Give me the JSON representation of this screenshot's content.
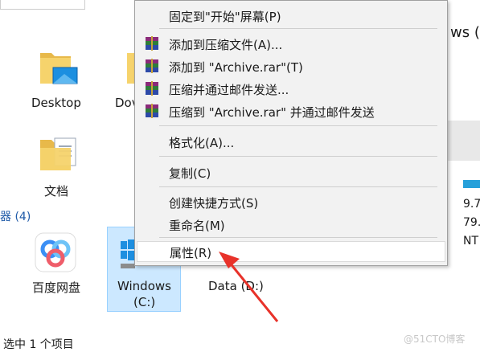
{
  "explorer": {
    "items": [
      {
        "label": "Desktop"
      },
      {
        "label": "Dov"
      },
      {
        "label": "文档"
      }
    ],
    "section_label": "器 (4)",
    "drives": [
      {
        "label": "百度网盘"
      },
      {
        "label_line1": "Windows",
        "label_line2": "(C:)"
      },
      {
        "label": "Data (D:)"
      }
    ],
    "status_text": "选中 1 个项目",
    "right_panel": {
      "title_fragment": "ws (",
      "line1": "9.7",
      "line2": "79.",
      "line3": "NT"
    },
    "colors": {
      "selection": "#cce8ff",
      "accent": "#26a0da",
      "arrow": "#e8322a"
    }
  },
  "context_menu": {
    "items": [
      {
        "label": "固定到\"开始\"屏幕(P)",
        "icon": null
      },
      {
        "label": "添加到压缩文件(A)...",
        "icon": "winrar-icon"
      },
      {
        "label": "添加到 \"Archive.rar\"(T)",
        "icon": "winrar-icon"
      },
      {
        "label": "压缩并通过邮件发送...",
        "icon": "winrar-icon"
      },
      {
        "label": "压缩到 \"Archive.rar\" 并通过邮件发送",
        "icon": "winrar-icon"
      },
      {
        "label": "格式化(A)...",
        "icon": null
      },
      {
        "label": "复制(C)",
        "icon": null
      },
      {
        "label": "创建快捷方式(S)",
        "icon": null
      },
      {
        "label": "重命名(M)",
        "icon": null
      },
      {
        "label": "属性(R)",
        "icon": null
      }
    ],
    "highlighted_item": "属性(R)"
  },
  "watermark": "@51CTO博客"
}
